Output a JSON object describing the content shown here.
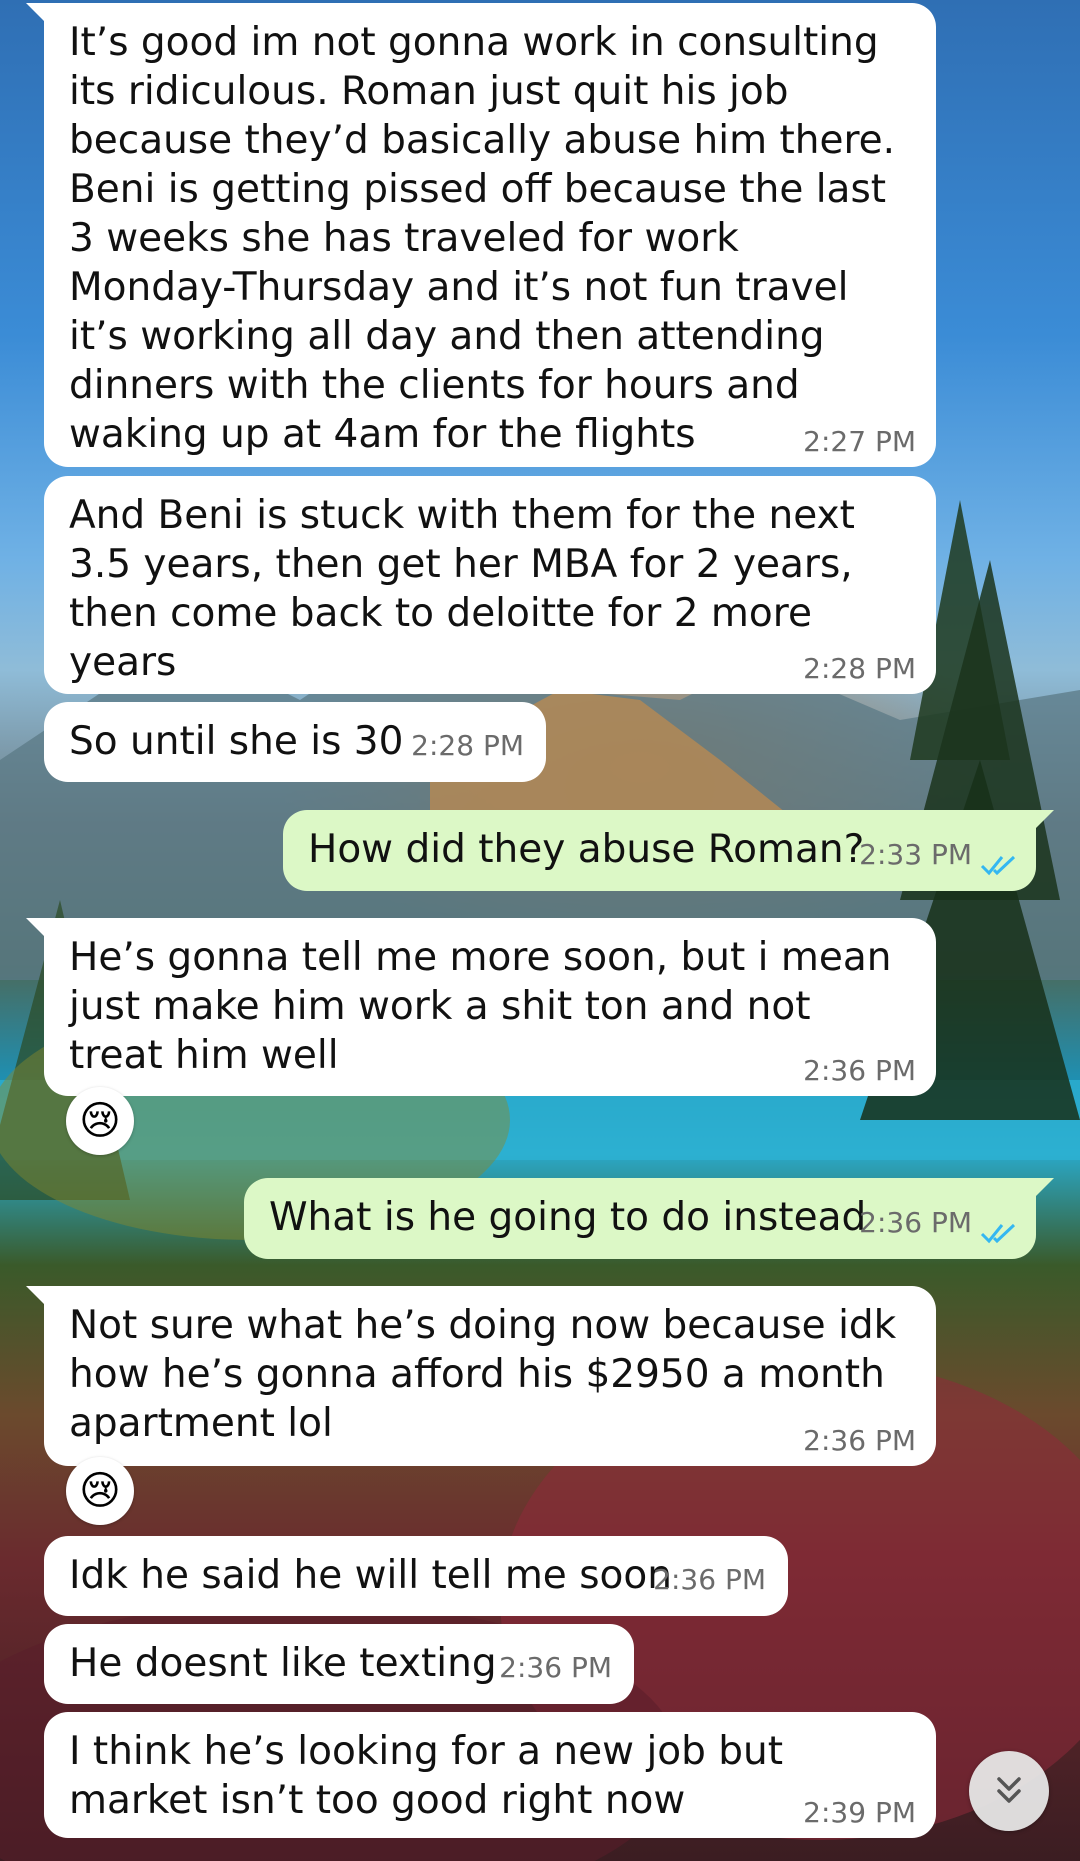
{
  "messages": [
    {
      "text": "It’s good im not gonna work in consulting its ridiculous. Roman just quit his job because they’d basically abuse him there. Beni is getting pissed off because the last 3 weeks she has traveled for work Monday-Thursday and it’s not fun travel it’s working all day and then attending dinners with the clients for hours and waking up at 4am for the flights",
      "time": "2:27 PM"
    },
    {
      "text": "And Beni is stuck with them for the next 3.5 years, then get her MBA for 2 years, then come back to deloitte for 2 more years",
      "time": "2:28 PM"
    },
    {
      "text": "So until she is 30",
      "time": "2:28 PM"
    },
    {
      "text": "How did they abuse Roman?",
      "time": "2:33 PM"
    },
    {
      "text": "He’s gonna tell me more soon, but i mean just make him work a shit ton and not treat him well",
      "time": "2:36 PM"
    },
    {
      "text": "What is he going to do instead",
      "time": "2:36 PM"
    },
    {
      "text": "Not sure what he’s doing now because idk how he’s gonna afford his $2950 a month apartment lol",
      "time": "2:36 PM"
    },
    {
      "text": "Idk he said he will tell me soon",
      "time": "2:36 PM"
    },
    {
      "text": "He doesnt like texting",
      "time": "2:36 PM"
    },
    {
      "text": "I think he’s looking for a new job but market isn’t too good right now",
      "time": "2:39 PM"
    }
  ],
  "reactions": {
    "emoji": "😢",
    "icon": "crying-face-icon"
  },
  "colors": {
    "incoming": "#ffffff",
    "outgoing": "#dcf8c6",
    "read_ticks": "#34b7f1",
    "time": "#6b6b6b"
  }
}
